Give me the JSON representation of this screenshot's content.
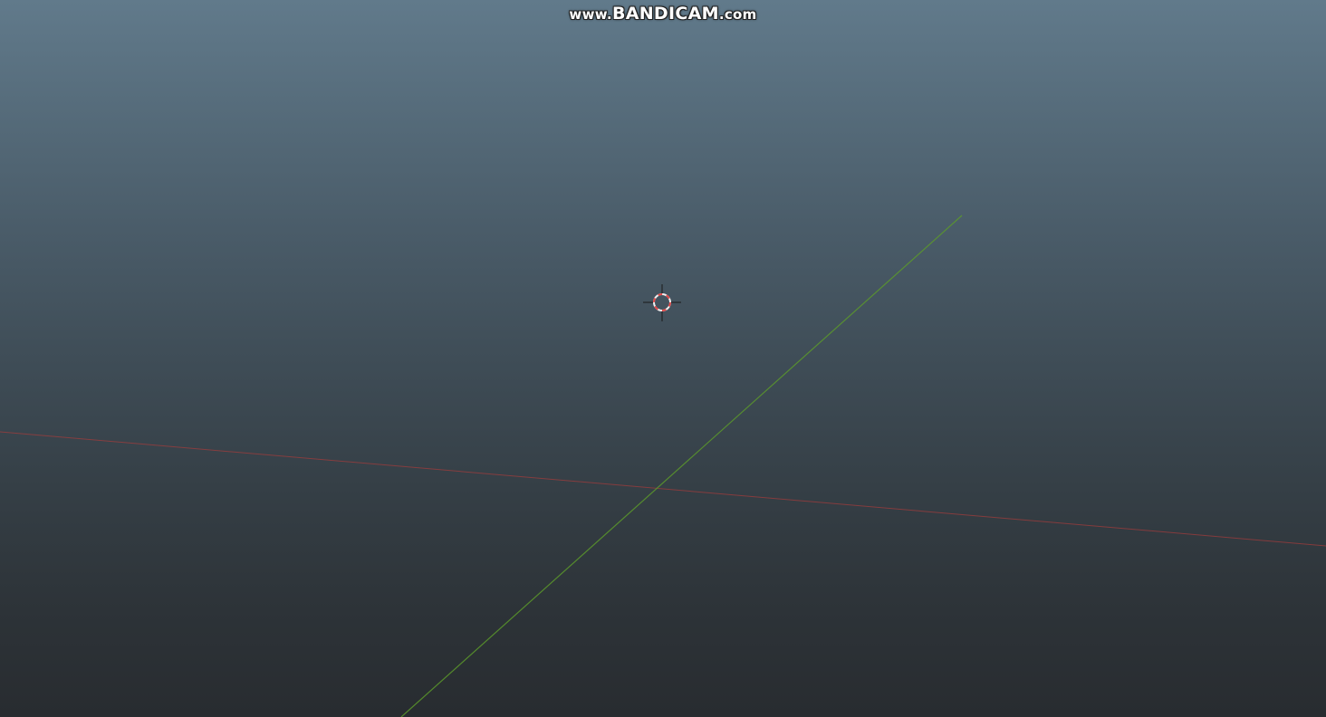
{
  "watermark": {
    "prefix": "www.",
    "brand": "BANDICAM",
    "suffix": ".com"
  },
  "viewport": {
    "x_axis_color": "#a03c3c",
    "y_axis_color": "#5c9a2a",
    "cursor_colors": [
      "#e04848",
      "#f0f0f0",
      "#1a1a1a"
    ]
  },
  "icons": {
    "cursor": "3d-cursor-icon"
  }
}
